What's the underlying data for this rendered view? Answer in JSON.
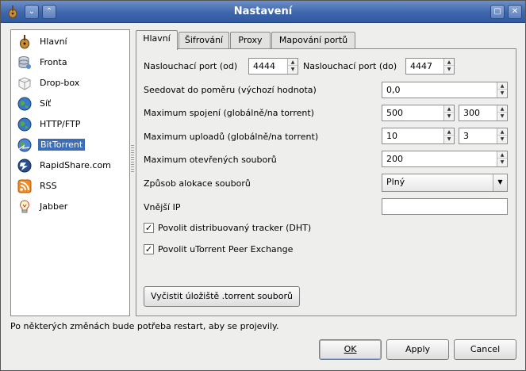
{
  "window": {
    "title": "Nastavení"
  },
  "sidebar": {
    "items": [
      {
        "label": "Hlavní",
        "icon": "mandolin-icon"
      },
      {
        "label": "Fronta",
        "icon": "database-icon"
      },
      {
        "label": "Drop-box",
        "icon": "box-icon"
      },
      {
        "label": "Síť",
        "icon": "globe-icon"
      },
      {
        "label": "HTTP/FTP",
        "icon": "globe-icon"
      },
      {
        "label": "BitTorrent",
        "icon": "globe-arrows-icon",
        "selected": true
      },
      {
        "label": "RapidShare.com",
        "icon": "rapidshare-icon"
      },
      {
        "label": "RSS",
        "icon": "rss-icon"
      },
      {
        "label": "Jabber",
        "icon": "lightbulb-icon"
      }
    ]
  },
  "tabs": [
    {
      "label": "Hlavní",
      "active": true
    },
    {
      "label": "Šifrování"
    },
    {
      "label": "Proxy"
    },
    {
      "label": "Mapování portů"
    }
  ],
  "form": {
    "port_from_label": "Naslouchací port (od)",
    "port_from_value": "4444",
    "port_to_label": "Naslouchací port (do)",
    "port_to_value": "4447",
    "seed_ratio_label": "Seedovat do poměru (výchozí hodnota)",
    "seed_ratio_value": "0,0",
    "max_conn_label": "Maximum spojení (globálně/na torrent)",
    "max_conn_global": "500",
    "max_conn_torrent": "300",
    "max_uploads_label": "Maximum uploadů (globálně/na torrent)",
    "max_uploads_global": "10",
    "max_uploads_torrent": "3",
    "max_files_label": "Maximum otevřených souborů",
    "max_files_value": "200",
    "alloc_label": "Způsob alokace souborů",
    "alloc_value": "Plný",
    "external_ip_label": "Vnější IP",
    "external_ip_value": "",
    "dht_label": "Povolit distribuovaný tracker (DHT)",
    "dht_checked": true,
    "pex_label": "Povolit uTorrent Peer Exchange",
    "pex_checked": true,
    "clear_button": "Vyčistit úložiště .torrent souborů"
  },
  "footer": {
    "restart_note": "Po některých změnách bude potřeba restart, aby se projevily.",
    "ok": "OK",
    "apply": "Apply",
    "cancel": "Cancel"
  },
  "colors": {
    "titlebar": "#3e66ad",
    "selection": "#3d6db4"
  }
}
